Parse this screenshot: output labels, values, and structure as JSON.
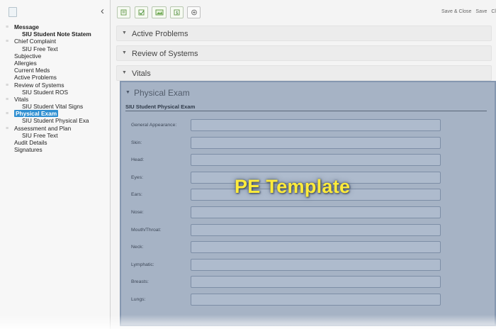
{
  "toolbar": {
    "links": [
      "Save & Close",
      "Save",
      "Cl"
    ]
  },
  "sidebar": {
    "items": [
      {
        "label": "Message",
        "level": 0,
        "bold": true,
        "bullet": true
      },
      {
        "label": "SIU Student Note Statem",
        "level": 1,
        "bold": true
      },
      {
        "label": "Chief Complaint",
        "level": 0,
        "bullet": true
      },
      {
        "label": "SIU Free Text",
        "level": 1
      },
      {
        "label": "Subjective",
        "level": 0
      },
      {
        "label": "Allergies",
        "level": 0
      },
      {
        "label": "Current Meds",
        "level": 0
      },
      {
        "label": "Active Problems",
        "level": 0
      },
      {
        "label": "Review of Systems",
        "level": 0,
        "bullet": true
      },
      {
        "label": "SIU Student ROS",
        "level": 1
      },
      {
        "label": "Vitals",
        "level": 0,
        "bullet": true
      },
      {
        "label": "SIU Student Vital Signs",
        "level": 1
      },
      {
        "label": "Physical Exam",
        "level": 0,
        "bullet": true,
        "selected": true
      },
      {
        "label": "SIU Student Physical Exa",
        "level": 1
      },
      {
        "label": "Assessment and Plan",
        "level": 0,
        "bullet": true
      },
      {
        "label": "SIU Free Text",
        "level": 1
      },
      {
        "label": "Audit Details",
        "level": 0
      },
      {
        "label": "Signatures",
        "level": 0
      }
    ]
  },
  "sections": [
    {
      "title": "Active Problems"
    },
    {
      "title": "Review of Systems"
    },
    {
      "title": "Vitals"
    }
  ],
  "physical_exam": {
    "title": "Physical Exam",
    "subheader": "SIU Student Physical Exam",
    "fields": [
      {
        "label": "General Appearance:",
        "value": ""
      },
      {
        "label": "Skin:",
        "value": ""
      },
      {
        "label": "Head:",
        "value": ""
      },
      {
        "label": "Eyes:",
        "value": ""
      },
      {
        "label": "Ears:",
        "value": ""
      },
      {
        "label": "Nose:",
        "value": ""
      },
      {
        "label": "Mouth/Throat:",
        "value": ""
      },
      {
        "label": "Neck:",
        "value": ""
      },
      {
        "label": "Lymphatic:",
        "value": ""
      },
      {
        "label": "Breasts:",
        "value": ""
      },
      {
        "label": "Lungs:",
        "value": ""
      }
    ]
  },
  "overlay": {
    "title": "PE Template"
  },
  "colors": {
    "accent_selected": "#2f8fd1",
    "panel_bg": "#a6b3c5",
    "overlay_text": "#ffeb3b"
  }
}
